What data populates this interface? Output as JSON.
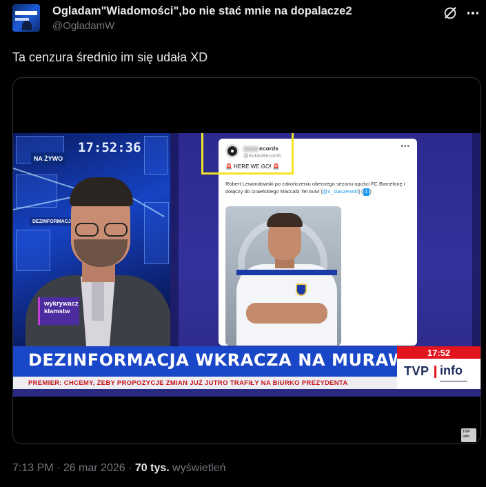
{
  "author": {
    "display_name": "Ogladam\"Wiadomości\",bo nie stać mnie na dopalacze2",
    "handle": "@OgladamW",
    "avatar_icon": "avatar-news-logo"
  },
  "header_icons": [
    "grok-icon",
    "more-icon"
  ],
  "tweet": {
    "text": "Ta cenzura średnio im się udała XD"
  },
  "media": {
    "studio": {
      "clock": "17:52:36",
      "live_badge": "NA ŻYWO",
      "tag": "DEZINFORMACJA WKRA",
      "side_badge": "wykrywacz kłamstw"
    },
    "embedded_tweet": {
      "name_suffix": "ecords",
      "handle": "@KutasRecords",
      "headline": "🚨 HERE WE GO! 🚨",
      "body_before": "Robert Lewandowski po zakończeniu obecnego sezonu opuści FC Barcelonę i dołączy do izraelskiego Maccabi Tel Aviv! [",
      "body_link": "@s_staszewski",
      "body_after": "] (",
      "body_pill": "1",
      "body_end": ")",
      "highlight_color": "#f4e322"
    },
    "lower_third": {
      "title": "DEZINFORMACJA WKRACZA NA MURAWĘ",
      "time": "17:52",
      "channel_a": "TVP",
      "channel_b": "info",
      "subtitle": "PREMIER: CHCEMY, ŻEBY PROPOZYCJE ZMIAN JUŻ JUTRO TRAFIŁY NA BIURKO PREZYDENTA",
      "bar_color": "#1a46c8",
      "accent_color": "#e2141d"
    },
    "watermark": "TVP info"
  },
  "meta": {
    "time": "7:13 PM",
    "separator": " · ",
    "date": "26 mar 2026",
    "views_count": "70 tys.",
    "views_label": "wyświetleń"
  }
}
